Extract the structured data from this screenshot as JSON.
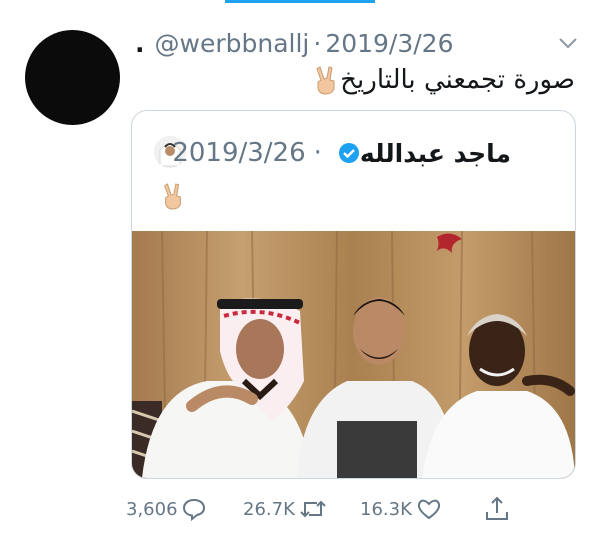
{
  "tweet": {
    "display_name": ".",
    "handle": "@werbbnallj",
    "date_separator": "·",
    "date": "2019/3/26",
    "text": "صورة تجمعني بالتاريخ"
  },
  "quoted_tweet": {
    "display_name": "ماجد عبدالله",
    "date_separator": "·",
    "date": "2019/3/26",
    "verified": true
  },
  "actions": {
    "replies": "3,606",
    "retweets": "26.7K",
    "likes": "16.3K"
  },
  "icons": {
    "reply": "reply-icon",
    "retweet": "retweet-icon",
    "like": "heart-icon",
    "share": "share-icon",
    "caret": "chevron-down-icon",
    "victory": "victory-hand-emoji",
    "verified": "verified-badge-icon"
  },
  "colors": {
    "accent": "#1da1f2",
    "muted": "#657786",
    "border": "#ccd6dd"
  }
}
